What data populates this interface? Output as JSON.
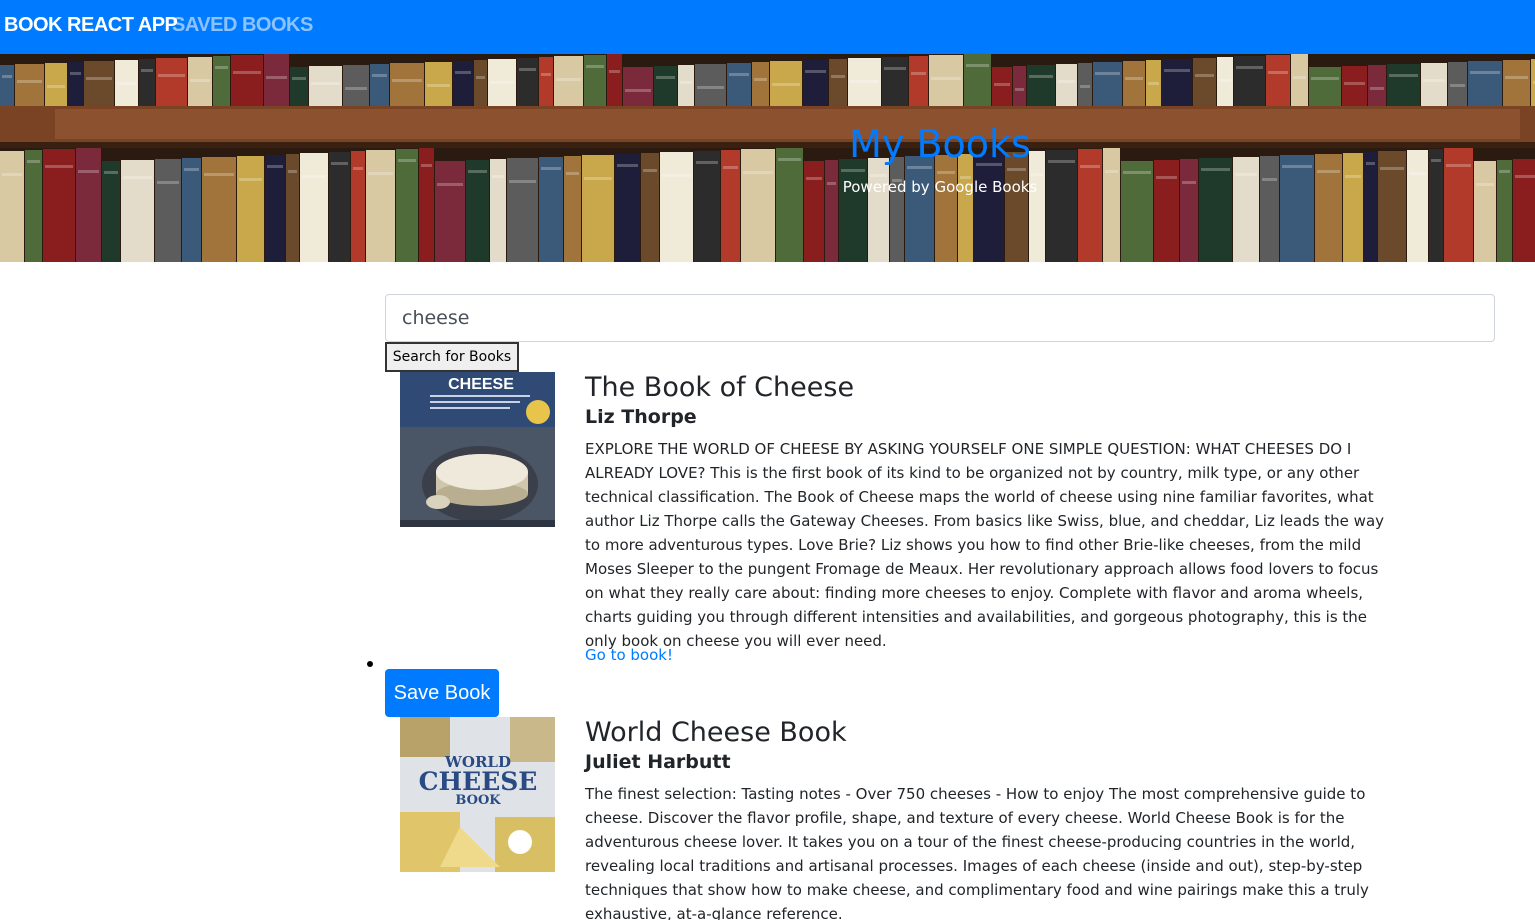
{
  "navbar": {
    "brand": "BOOK REACT APP",
    "saved_link": "SAVED BOOKS"
  },
  "hero": {
    "title": "My Books",
    "subtitle": "Powered by Google Books"
  },
  "search": {
    "value": "cheese",
    "button_label": "Search for Books"
  },
  "books": [
    {
      "title": "The Book of Cheese",
      "author": "Liz Thorpe",
      "description": "EXPLORE THE WORLD OF CHEESE BY ASKING YOURSELF ONE SIMPLE QUESTION: WHAT CHEESES DO I ALREADY LOVE? This is the first book of its kind to be organized not by country, milk type, or any other technical classification. The Book of Cheese maps the world of cheese using nine familiar favorites, what author Liz Thorpe calls the Gateway Cheeses. From basics like Swiss, blue, and cheddar, Liz leads the way to more adventurous types. Love Brie? Liz shows you how to find other Brie-like cheeses, from the mild Moses Sleeper to the pungent Fromage de Meaux. Her revolutionary approach allows food lovers to focus on what they really care about: finding more cheeses to enjoy. Complete with flavor and aroma wheels, charts guiding you through different intensities and availabilities, and gorgeous photography, this is the only book on cheese you will ever need.",
      "link_label": "Go to book!",
      "save_label": "Save Book",
      "cover_text": "CHEESE"
    },
    {
      "title": "World Cheese Book",
      "author": "Juliet Harbutt",
      "description": "The finest selection: Tasting notes - Over 750 cheeses - How to enjoy The most comprehensive guide to cheese. Discover the flavor profile, shape, and texture of every cheese. World Cheese Book is for the adventurous cheese lover. It takes you on a tour of the finest cheese-producing countries in the world, revealing local traditions and artisanal processes. Images of each cheese (inside and out), step-by-step techniques that show how to make cheese, and complimentary food and wine pairings make this a truly exhaustive, at-a-glance reference.",
      "cover_text_top": "WORLD",
      "cover_text_mid": "CHEESE",
      "cover_text_bot": "BOOK"
    }
  ],
  "colors": {
    "primary": "#007bff",
    "text": "#212529"
  }
}
